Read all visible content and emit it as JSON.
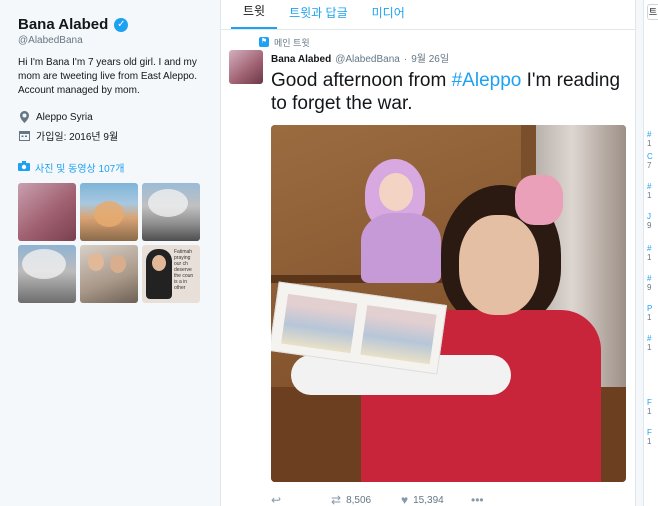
{
  "profile": {
    "name": "Bana Alabed",
    "handle": "@AlabedBana",
    "bio": "Hi I'm Bana I'm 7 years old girl. I and my mom are tweeting live from East Aleppo. Account managed by mom.",
    "location": "Aleppo Syria",
    "joined": "가입일: 2016년 9월",
    "media_label": "사진 및 동영상 107개"
  },
  "tabs": [
    "트윗",
    "트윗과 답글",
    "미디어"
  ],
  "tweet": {
    "pinned_label": "메인 트윗",
    "author": "Bana Alabed",
    "handle": "@AlabedBana",
    "date": "9월 26일",
    "text_before": "Good afternoon from ",
    "hashtag": "#Aleppo",
    "text_after": " I'm reading to forget the war.",
    "retweets": "8,506",
    "likes": "15,394"
  },
  "right_column": {
    "button_char": "트",
    "items": [
      {
        "head": "#",
        "num": "1"
      },
      {
        "head": "C",
        "num": "7"
      },
      {
        "head": "#",
        "num": "1"
      },
      {
        "head": "J",
        "num": "9"
      },
      {
        "head": "#",
        "num": "1"
      },
      {
        "head": "#",
        "num": "9"
      },
      {
        "head": "P",
        "num": "1"
      },
      {
        "head": "#",
        "num": "1"
      },
      {
        "head": "F",
        "num": "1"
      },
      {
        "head": "F",
        "num": "1"
      }
    ]
  },
  "colors": {
    "accent": "#1da1f2",
    "text": "#14171a",
    "muted": "#657786"
  }
}
